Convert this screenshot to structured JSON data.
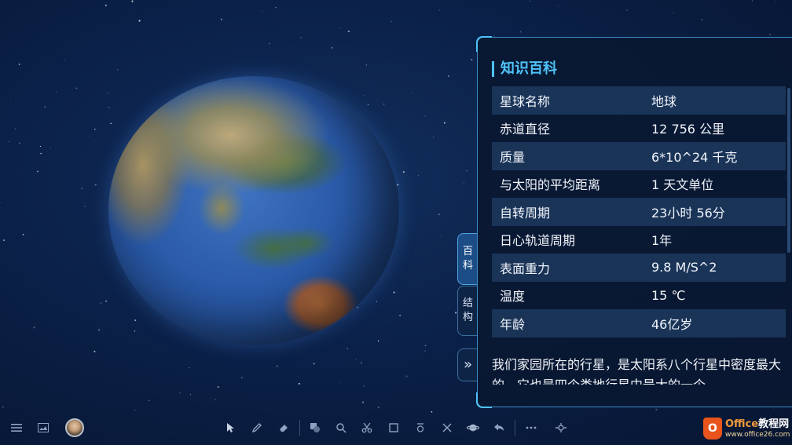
{
  "panel": {
    "title": "知识百科",
    "rows": [
      {
        "label": "星球名称",
        "value": "地球"
      },
      {
        "label": "赤道直径",
        "value": "12 756 公里"
      },
      {
        "label": "质量",
        "value": "6*10^24 千克"
      },
      {
        "label": "与太阳的平均距离",
        "value": "1 天文单位"
      },
      {
        "label": "自转周期",
        "value": "23小时 56分"
      },
      {
        "label": "日心轨道周期",
        "value": "1年"
      },
      {
        "label": "表面重力",
        "value": "9.8 M/S^2"
      },
      {
        "label": "温度",
        "value": "15 ℃"
      },
      {
        "label": "年龄",
        "value": "46亿岁"
      }
    ],
    "description": "我们家园所在的行星，是太阳系八个行星中密度最大的，它也是四个类地行星中最大的一个"
  },
  "side_tabs": {
    "baike": [
      "百",
      "科"
    ],
    "jiegou": [
      "结",
      "构"
    ],
    "expand": "»"
  },
  "watermark": {
    "brand_office": "Office",
    "brand_rest": "教程网",
    "url": "www.office26.com",
    "logo_letter": "O"
  },
  "colors": {
    "accent": "#4fc3f7",
    "panel_bg": "#0a1832",
    "row_highlight": "#1a3458"
  },
  "toolbar": {
    "icons": [
      "menu-icon",
      "image-icon",
      "avatar",
      "pointer-icon",
      "pen-icon",
      "eraser-icon",
      "shapes-icon",
      "search-icon",
      "scissors-icon",
      "crop-icon",
      "zoom-icon",
      "tools-icon",
      "planet-icon",
      "undo-icon",
      "more-icon",
      "settings-icon"
    ]
  }
}
